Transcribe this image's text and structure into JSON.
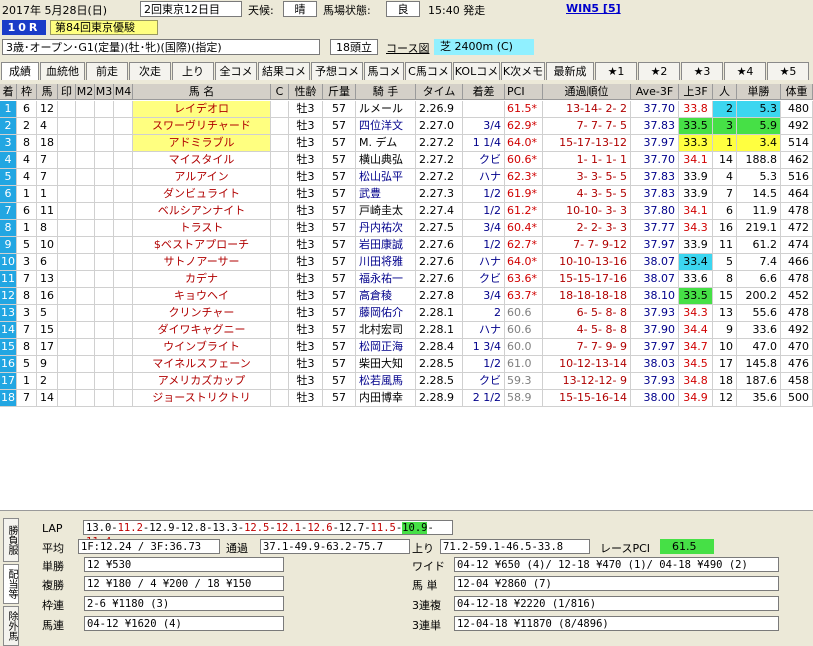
{
  "header": {
    "date": "2017年 5月28日(日)",
    "meeting": "2回東京12日目",
    "weather_label": "天候:",
    "weather": "晴",
    "track_label": "馬場状態:",
    "track": "良",
    "post_time": "15:40 発走",
    "win5_link": "WIN5 [5]",
    "race_no": "10R",
    "race_name": "第84回東京優駿",
    "conditions": "3歳･オープン･G1(定量)(牡･牝)(国際)(指定)",
    "runners": "18頭立",
    "course_button": "コース図",
    "course": "芝 2400m (C)"
  },
  "tabs": [
    "成績",
    "血統他",
    "前走",
    "次走",
    "上り",
    "全コメ",
    "結果コメ",
    "予想コメ",
    "馬コメ",
    "C馬コメ",
    "KOLコメ",
    "K次メモ",
    "最新成",
    "★1",
    "★2",
    "★3",
    "★4",
    "★5"
  ],
  "columns": [
    "着",
    "枠",
    "馬",
    "印",
    "M2",
    "M3",
    "M4",
    "馬 名",
    "C",
    "性齢",
    "斤量",
    "騎 手",
    "タイム",
    "着差",
    "PCI",
    "通過順位",
    "Ave-3F",
    "上3F",
    "人",
    "単勝",
    "体重"
  ],
  "rows": [
    {
      "pos": "1",
      "waku": "6",
      "uma": "12",
      "name": "レイデオロ",
      "sex": "牡3",
      "kin": "57",
      "jockey": "ルメール",
      "time": "2.26.9",
      "diff": "",
      "pci": "61.5*",
      "passing": "13-14- 2- 2",
      "ave": "37.70",
      "last3f": "33.8",
      "pop": "2",
      "odds": "5.3",
      "weight": "480"
    },
    {
      "pos": "2",
      "waku": "2",
      "uma": "4",
      "name": "スワーヴリチャード",
      "sex": "牡3",
      "kin": "57",
      "jockey": "四位洋文",
      "time": "2.27.0",
      "diff": "3/4",
      "pci": "62.9*",
      "passing": "7- 7- 7- 5",
      "ave": "37.83",
      "last3f": "33.5",
      "pop": "3",
      "odds": "5.9",
      "weight": "492"
    },
    {
      "pos": "3",
      "waku": "8",
      "uma": "18",
      "name": "アドミラブル",
      "sex": "牡3",
      "kin": "57",
      "jockey": "M. デム",
      "time": "2.27.2",
      "diff": "1 1/4",
      "pci": "64.0*",
      "passing": "15-17-13-12",
      "ave": "37.97",
      "last3f": "33.3",
      "pop": "1",
      "odds": "3.4",
      "weight": "514"
    },
    {
      "pos": "4",
      "waku": "4",
      "uma": "7",
      "name": "マイスタイル",
      "sex": "牡3",
      "kin": "57",
      "jockey": "横山典弘",
      "time": "2.27.2",
      "diff": "クビ",
      "pci": "60.6*",
      "passing": "1- 1- 1- 1",
      "ave": "37.70",
      "last3f": "34.1",
      "pop": "14",
      "odds": "188.8",
      "weight": "462"
    },
    {
      "pos": "5",
      "waku": "4",
      "uma": "7",
      "name": "アルアイン",
      "sex": "牡3",
      "kin": "57",
      "jockey": "松山弘平",
      "time": "2.27.2",
      "diff": "ハナ",
      "pci": "62.3*",
      "passing": "3- 3- 5- 5",
      "ave": "37.83",
      "last3f": "33.9",
      "pop": "4",
      "odds": "5.3",
      "weight": "516"
    },
    {
      "pos": "6",
      "waku": "1",
      "uma": "1",
      "name": "ダンビュライト",
      "sex": "牡3",
      "kin": "57",
      "jockey": "武豊",
      "time": "2.27.3",
      "diff": "1/2",
      "pci": "61.9*",
      "passing": "4- 3- 5- 5",
      "ave": "37.83",
      "last3f": "33.9",
      "pop": "7",
      "odds": "14.5",
      "weight": "464"
    },
    {
      "pos": "7",
      "waku": "6",
      "uma": "11",
      "name": "ベルシアンナイト",
      "sex": "牡3",
      "kin": "57",
      "jockey": "戸崎圭太",
      "time": "2.27.4",
      "diff": "1/2",
      "pci": "61.2*",
      "passing": "10-10- 3- 3",
      "ave": "37.80",
      "last3f": "34.1",
      "pop": "6",
      "odds": "11.9",
      "weight": "478"
    },
    {
      "pos": "8",
      "waku": "1",
      "uma": "8",
      "name": "トラスト",
      "sex": "牡3",
      "kin": "57",
      "jockey": "丹内祐次",
      "time": "2.27.5",
      "diff": "3/4",
      "pci": "60.4*",
      "passing": "2- 2- 3- 3",
      "ave": "37.77",
      "last3f": "34.3",
      "pop": "16",
      "odds": "219.1",
      "weight": "472"
    },
    {
      "pos": "9",
      "waku": "5",
      "uma": "10",
      "name": "$ベストアプローチ",
      "sex": "牡3",
      "kin": "57",
      "jockey": "岩田康誠",
      "time": "2.27.6",
      "diff": "1/2",
      "pci": "62.7*",
      "passing": "7- 7- 9-12",
      "ave": "37.97",
      "last3f": "33.9",
      "pop": "11",
      "odds": "61.2",
      "weight": "474"
    },
    {
      "pos": "10",
      "waku": "3",
      "uma": "6",
      "name": "サトノアーサー",
      "sex": "牡3",
      "kin": "57",
      "jockey": "川田将雅",
      "time": "2.27.6",
      "diff": "ハナ",
      "pci": "64.0*",
      "passing": "10-10-13-16",
      "ave": "38.07",
      "last3f": "33.4",
      "pop": "5",
      "odds": "7.4",
      "weight": "466"
    },
    {
      "pos": "11",
      "waku": "7",
      "uma": "13",
      "name": "カデナ",
      "sex": "牡3",
      "kin": "57",
      "jockey": "福永祐一",
      "time": "2.27.6",
      "diff": "クビ",
      "pci": "63.6*",
      "passing": "15-15-17-16",
      "ave": "38.07",
      "last3f": "33.6",
      "pop": "8",
      "odds": "6.6",
      "weight": "478"
    },
    {
      "pos": "12",
      "waku": "8",
      "uma": "16",
      "name": "キョウヘイ",
      "sex": "牡3",
      "kin": "57",
      "jockey": "高倉稜",
      "time": "2.27.8",
      "diff": "3/4",
      "pci": "63.7*",
      "passing": "18-18-18-18",
      "ave": "38.10",
      "last3f": "33.5",
      "pop": "15",
      "odds": "200.2",
      "weight": "452"
    },
    {
      "pos": "13",
      "waku": "3",
      "uma": "5",
      "name": "クリンチャー",
      "sex": "牡3",
      "kin": "57",
      "jockey": "藤岡佑介",
      "time": "2.28.1",
      "diff": "2",
      "pci": "60.6",
      "passing": "6- 5- 8- 8",
      "ave": "37.93",
      "last3f": "34.3",
      "pop": "13",
      "odds": "55.6",
      "weight": "478"
    },
    {
      "pos": "14",
      "waku": "7",
      "uma": "15",
      "name": "ダイワキャグニー",
      "sex": "牡3",
      "kin": "57",
      "jockey": "北村宏司",
      "time": "2.28.1",
      "diff": "ハナ",
      "pci": "60.6",
      "passing": "4- 5- 8- 8",
      "ave": "37.90",
      "last3f": "34.4",
      "pop": "9",
      "odds": "33.6",
      "weight": "492"
    },
    {
      "pos": "15",
      "waku": "8",
      "uma": "17",
      "name": "ウインブライト",
      "sex": "牡3",
      "kin": "57",
      "jockey": "松岡正海",
      "time": "2.28.4",
      "diff": "1 3/4",
      "pci": "60.0",
      "passing": "7- 7- 9- 9",
      "ave": "37.97",
      "last3f": "34.7",
      "pop": "10",
      "odds": "47.0",
      "weight": "470"
    },
    {
      "pos": "16",
      "waku": "5",
      "uma": "9",
      "name": "マイネルスフェーン",
      "sex": "牡3",
      "kin": "57",
      "jockey": "柴田大知",
      "time": "2.28.5",
      "diff": "1/2",
      "pci": "61.0",
      "passing": "10-12-13-14",
      "ave": "38.03",
      "last3f": "34.5",
      "pop": "17",
      "odds": "145.8",
      "weight": "476"
    },
    {
      "pos": "17",
      "waku": "1",
      "uma": "2",
      "name": "アメリカズカップ",
      "sex": "牡3",
      "kin": "57",
      "jockey": "松若風馬",
      "time": "2.28.5",
      "diff": "クビ",
      "pci": "59.3",
      "passing": "13-12-12- 9",
      "ave": "37.93",
      "last3f": "34.8",
      "pop": "18",
      "odds": "187.6",
      "weight": "458"
    },
    {
      "pos": "18",
      "waku": "7",
      "uma": "14",
      "name": "ジョーストリクトリ",
      "sex": "牡3",
      "kin": "57",
      "jockey": "内田博幸",
      "time": "2.28.9",
      "diff": "2 1/2",
      "pci": "58.9",
      "passing": "15-15-16-14",
      "ave": "38.00",
      "last3f": "34.9",
      "pop": "12",
      "odds": "35.6",
      "weight": "500"
    }
  ],
  "footer": {
    "lap_label": "LAP",
    "lap_parts": [
      "13.0-",
      "11.2",
      "-12.9-12.8-13.3-",
      "12.5",
      "-",
      "12.1",
      "-",
      "12.6",
      "-12.7-",
      "11.5",
      "-",
      "10.9",
      "-",
      "11.4"
    ],
    "avg_label": "平均",
    "avg_value": "1F:12.24 / 3F:36.73",
    "pass_label": "通過",
    "pass_value": "37.1-49.9-63.2-75.7",
    "agari_label": "上り",
    "agari_value": "71.2-59.1-46.5-33.8",
    "race_pci_label": "レースPCI",
    "race_pci": "61.5",
    "side_tabs": [
      "勝負服",
      "配当等",
      "除外馬"
    ],
    "payouts": [
      {
        "label": "単勝",
        "value": "12 ¥530"
      },
      {
        "label": "複勝",
        "value": "12 ¥180 / 4 ¥200 / 18 ¥150"
      },
      {
        "label": "枠連",
        "value": "2-6 ¥1180 (3)"
      },
      {
        "label": "馬連",
        "value": "04-12 ¥1620 (4)"
      }
    ],
    "payouts_right": [
      {
        "label": "ワイド",
        "value": "04-12 ¥650 (4)/ 12-18 ¥470 (1)/ 04-18 ¥490 (2)"
      },
      {
        "label": "馬 単",
        "value": "12-04 ¥2860 (7)"
      },
      {
        "label": "3連複",
        "value": "04-12-18 ¥2220 (1/816)"
      },
      {
        "label": "3連単",
        "value": "12-04-18 ¥11870 (8/4896)"
      }
    ]
  },
  "colors": {
    "frame": [
      "#ffffff",
      "#000000",
      "#e8312b",
      "#1a56c8",
      "#f2d600",
      "#1e9e3a",
      "#f07a1a",
      "#f5a0c8"
    ],
    "accent_green": "#46e046",
    "accent_cyan": "#3cd6f0",
    "accent_yellow": "#ffff40"
  }
}
